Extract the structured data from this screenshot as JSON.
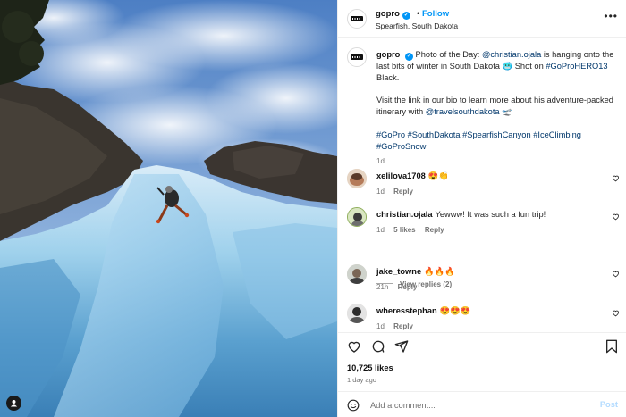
{
  "post": {
    "username": "gopro",
    "verified_mark": "✓",
    "separator": "•",
    "follow_label": "Follow",
    "location": "Spearfish, South Dakota",
    "more_label": "•••",
    "photo_alt": "Climber hanging onto a frozen ice waterfall under a cloudy blue sky"
  },
  "caption": {
    "username": "gopro",
    "line_1_prefix": "Photo of the Day: ",
    "mention_1": "@christian.ojala",
    "line_1_rest": " is hanging onto the last bits of winter in South Dakota 🥶 Shot on ",
    "hashtag_1": "#GoProHERO13",
    "line_1_end": " Black.",
    "paragraph_2": "Visit the link in our bio to learn more about his adventure-packed itinerary with ",
    "mention_2": "@travelsouthdakota",
    "paragraph_2_end": " 🛫",
    "hashtags": "#GoPro #SouthDakota #SpearfishCanyon #IceClimbing #GoProSnow",
    "time": "1d"
  },
  "comments": [
    {
      "username": "xelilova1708",
      "text": "😍👏",
      "time": "1d",
      "likes": "",
      "reply_label": "Reply"
    },
    {
      "username": "christian.ojala",
      "text": "Yewww! It was such a fun trip!",
      "time": "1d",
      "likes": "5 likes",
      "reply_label": "Reply"
    },
    {
      "username": "jake_towne",
      "text": "🔥🔥🔥",
      "time": "21h",
      "likes": "",
      "reply_label": "Reply"
    },
    {
      "username": "wheresstephan",
      "text": "😍😍😍",
      "time": "1d",
      "likes": "",
      "reply_label": "Reply"
    }
  ],
  "view_replies_label": "View replies (2)",
  "actions": {
    "likes": "10,725 likes",
    "age": "1 day ago"
  },
  "add_comment": {
    "placeholder": "Add a comment...",
    "post_label": "Post"
  },
  "colors": {
    "link_blue": "#0095f6",
    "hashtag_navy": "#00376b",
    "muted_gray": "#737373",
    "post_disabled": "#b3dbff"
  }
}
